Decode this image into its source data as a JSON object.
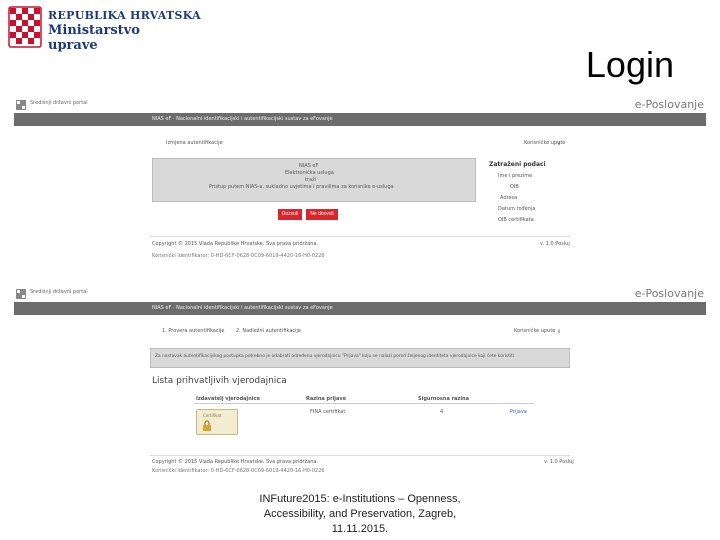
{
  "header": {
    "line1": "REPUBLIKA HRVATSKA",
    "line2": "Ministarstvo",
    "line3": "uprave",
    "slide_title": "Login"
  },
  "shot1": {
    "topbar_label": "Središnji državni portal",
    "brand": "e-Poslovanje",
    "navbar": "NIAS eF · Nacionalni identifikacijski i autentifikacijski sustav za eFovanje",
    "left_link": "Izmjena autentifikacije",
    "help_link": "Korisničke upute",
    "box_title": "NIAS eF",
    "box_lines": [
      "Elektronička usluga",
      "traži",
      "Pristup putem NIAS-a, sukladno uvjetima i pravilima za korisnike e-usluga"
    ],
    "btn_allow": "Dozvoli",
    "btn_deny": "Ne dozvoli",
    "side_title": "Zatraženi podaci",
    "side_items": [
      "Ime i prezime",
      "OIB",
      "Adresa",
      "Datum rođenja",
      "OIB certifikata"
    ],
    "copyright": "Copyright © 2015 Vlada Republike Hrvatske. Sva prava pridržana.",
    "version": "v. 1.0 Posluj",
    "session": "Korisnički identifikator: 0-HD-6CF-0628-0C09-6019-4420-16-H0-0226"
  },
  "shot2": {
    "topbar_label": "Središnji državni portal",
    "brand": "e-Poslovanje",
    "navbar": "NIAS eF · Nacionalni identifikacijski i autentifikacijski sustav za eFovanje",
    "step1": "1. Provera autentifikacije",
    "step2": "2. Nadležni autentifikacije",
    "help_link": "Korisničke upute",
    "info": "Za nastavak autentifikacijskog postupka potrebno je odabrati određenu vjerodajnicu \"Prijava\" koju se nalazi pored željenog identiteta vjerodajnice koji ćete koristiti.",
    "list_title": "Lista prihvatljivih vjerodajnica",
    "table_headers": [
      "Izdavatelj vjerodajnice",
      "Razina prijave",
      "Sigurnosna razina",
      ""
    ],
    "row": [
      "FINA certifikat",
      "4",
      "Prijava"
    ],
    "card_text": "Certifikat",
    "copyright": "Copyright © 2015 Vlada Republike Hrvatske. Sva prava pridržana.",
    "version": "v. 1.0 Posluj",
    "session": "Korisnički identifikator: 0-HD-6CF-0628-0C09-6019-4420-16-H0-0226"
  },
  "footer": {
    "note": "INFuture2015: e-Institutions – Openness, Accessibility, and Preservation, Zagreb, 11.11.2015."
  },
  "colors": {
    "accent_red": "#d9262c",
    "nav_gray": "#6c6c6c",
    "ministry_blue": "#1d3a78"
  }
}
